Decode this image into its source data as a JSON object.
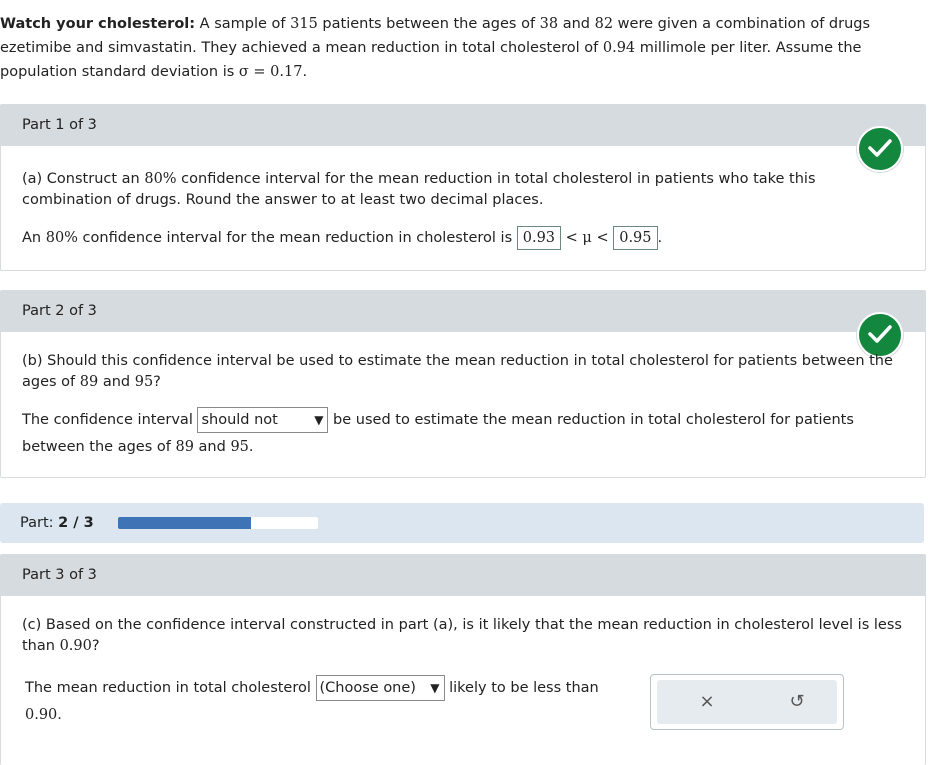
{
  "intro": {
    "title": "Watch your cholesterol:",
    "t1": " A sample of ",
    "n": "315",
    "t2": " patients between the ages of ",
    "age_low": "38",
    "t3": " and ",
    "age_high": "82",
    "t4": " were given a combination of drugs ezetimibe and simvastatin. They achieved a mean reduction in total cholesterol of ",
    "mean": "0.94",
    "t5": " millimole per liter. Assume the population standard deviation is ",
    "sigma": "σ = 0.17",
    "t6": "."
  },
  "part1": {
    "header": "Part 1 of 3",
    "q_a": "(a) Construct an ",
    "q_pct": "80%",
    "q_b": " confidence interval for the mean reduction in total cholesterol in patients who take this combination of drugs. Round the answer to at least two decimal places.",
    "ans_a": "An ",
    "ans_pct": "80%",
    "ans_b": " confidence interval for the mean reduction in cholesterol is ",
    "lower": "0.93",
    "mid": " < μ < ",
    "upper": "0.95",
    "end": "."
  },
  "part2": {
    "header": "Part 2 of 3",
    "q_a": "(b) Should this confidence interval be used to estimate the mean reduction in total cholesterol for patients between the ages of ",
    "age1": "89",
    "q_and": " and ",
    "age2": "95",
    "q_end": "?",
    "ans_a": "The confidence interval ",
    "selected": "should not",
    "ans_b": " be used to estimate the mean reduction in total cholesterol for patients between the ages of ",
    "ans_age1": "89",
    "ans_and": " and ",
    "ans_age2": "95",
    "ans_end": "."
  },
  "progress": {
    "label": "Part: ",
    "value": "2 / 3",
    "fraction": 0.665
  },
  "part3": {
    "header": "Part 3 of 3",
    "q_a": "(c) Based on the confidence interval constructed in part (a), is it likely that the mean reduction in cholesterol level is less than ",
    "q_val": "0.90",
    "q_end": "?",
    "ans_a": "The mean reduction in total cholesterol ",
    "selected": "(Choose one)",
    "ans_b": " likely to be less than ",
    "ans_val": "0.90",
    "ans_end": "."
  },
  "icons": {
    "check": "check-icon",
    "dropdown": "▼",
    "clear": "×",
    "reset": "↺"
  },
  "colors": {
    "success": "#14873f",
    "progress_fill": "#3e73b5",
    "header_bg": "#d6dbdf"
  }
}
